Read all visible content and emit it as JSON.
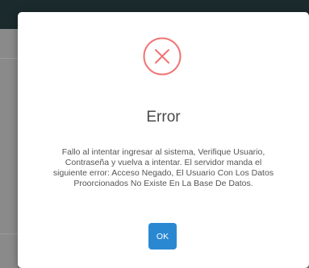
{
  "dialog": {
    "title": "Error",
    "message": "Fallo al intentar ingresar al sistema, Verifique Usuario, Contraseña y vuelva a intentar. El servidor manda el siguiente error: Acceso Negado, El Usuario Con Los Datos Proorcionados No Existe En La Base De Datos.",
    "ok_label": "OK",
    "icon": "error-x-icon"
  },
  "colors": {
    "error": "#f27474",
    "button": "#2a88d3",
    "topbar": "#1b2a2d"
  }
}
